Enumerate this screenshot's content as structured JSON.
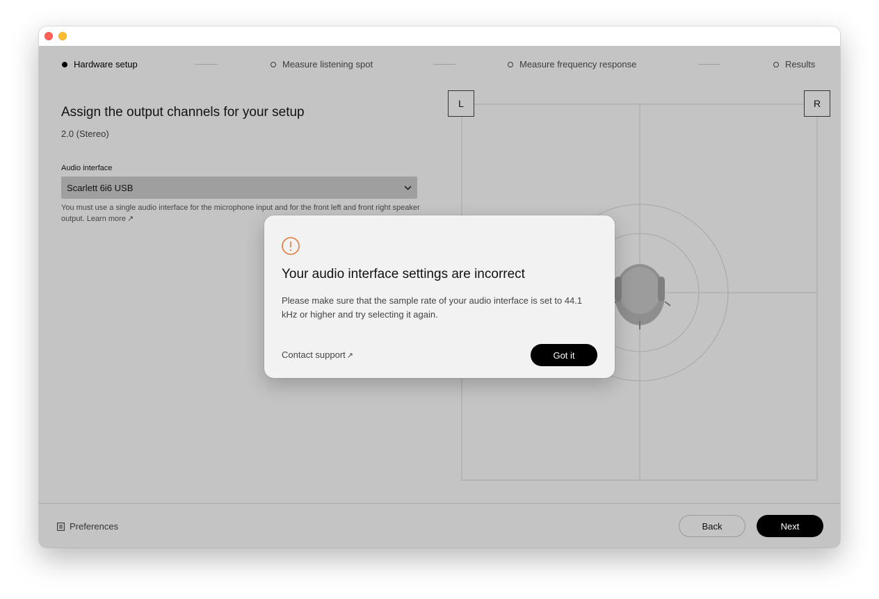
{
  "steps": [
    {
      "label": "Hardware setup",
      "active": true
    },
    {
      "label": "Measure listening spot",
      "active": false
    },
    {
      "label": "Measure frequency response",
      "active": false
    },
    {
      "label": "Results",
      "active": false
    }
  ],
  "main": {
    "heading": "Assign the output channels for your setup",
    "subheading": "2.0 (Stereo)",
    "audio_label": "Audio interface",
    "audio_value": "Scarlett 6i6 USB",
    "helper_text": "You must use a single audio interface for the microphone input and for the front left and front right speaker output.",
    "learn_more": "Learn more",
    "arrow": "↗"
  },
  "diagram": {
    "left_speaker": "L",
    "right_speaker": "R"
  },
  "footer": {
    "preferences": "Preferences",
    "back": "Back",
    "next": "Next"
  },
  "dialog": {
    "title": "Your audio interface settings are incorrect",
    "body": "Please make sure that the sample rate of your audio interface is set to 44.1 kHz or higher and try selecting it again.",
    "support": "Contact support",
    "confirm": "Got it",
    "icon": "warning-circle-icon",
    "accent": "#e07a3c"
  },
  "colors": {
    "window_dim": "#c4c4c4",
    "dialog_bg": "#f2f2f2",
    "primary_button": "#000000"
  }
}
